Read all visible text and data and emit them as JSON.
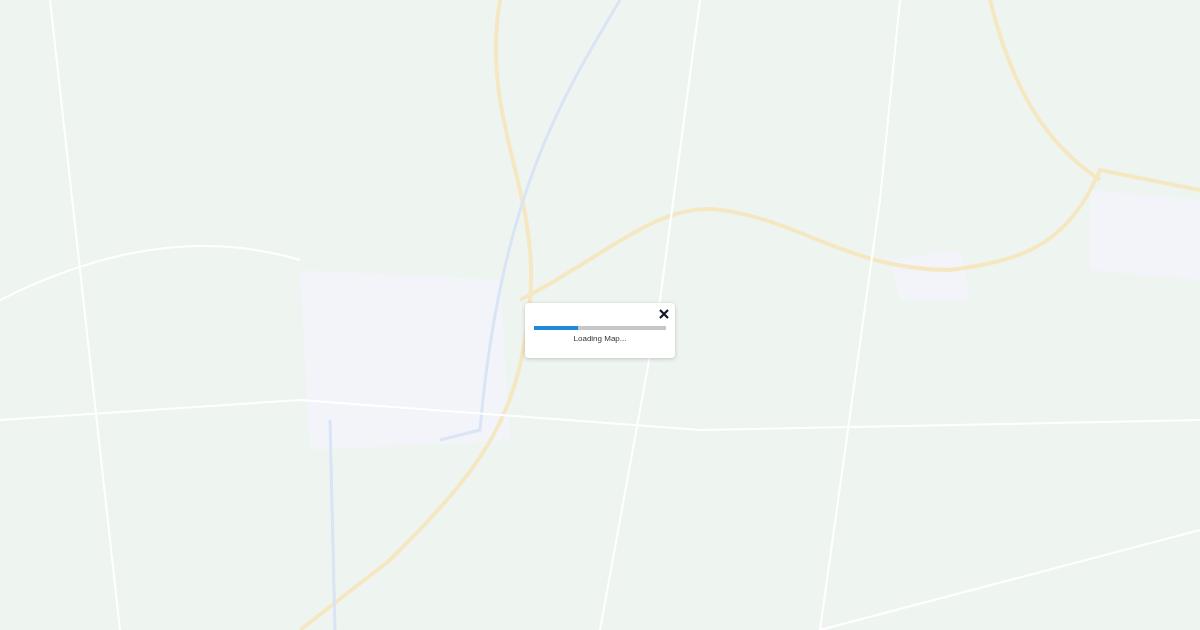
{
  "loading_dialog": {
    "message": "Loading Map...",
    "level": 0.33
  }
}
